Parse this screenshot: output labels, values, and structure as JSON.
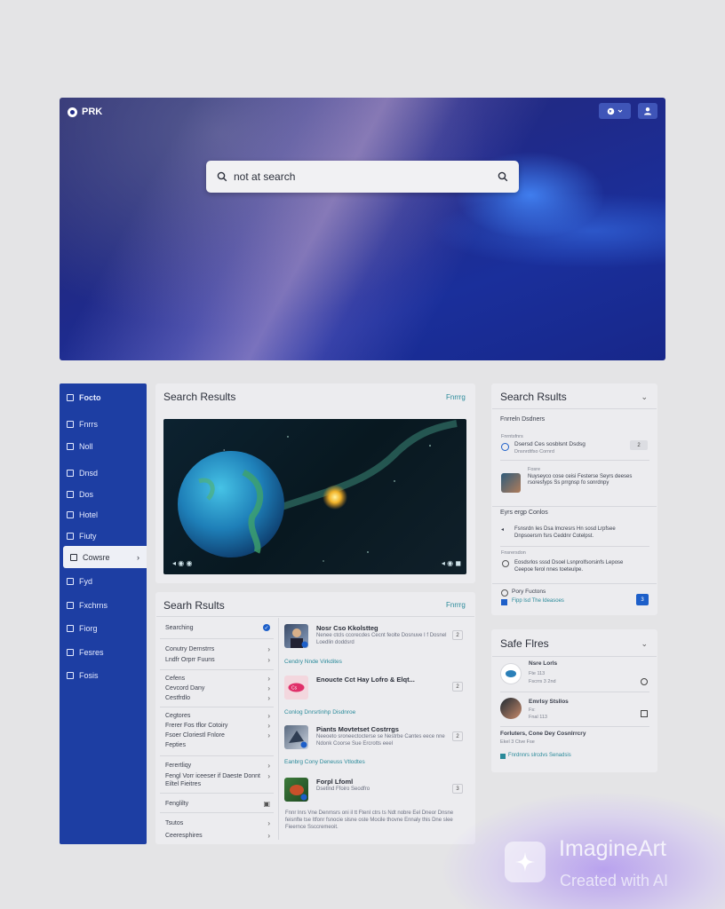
{
  "hero": {
    "brand": "PRK",
    "search_value": "not at search"
  },
  "sidebar": {
    "items": [
      {
        "label": "Focto"
      },
      {
        "label": "Fnrrs"
      },
      {
        "label": "Noll"
      },
      {
        "label": "Dnsd"
      },
      {
        "label": "Dos"
      },
      {
        "label": "Hotel"
      },
      {
        "label": "Fiuty"
      },
      {
        "label": "Cowsre"
      },
      {
        "label": "Fyd"
      },
      {
        "label": "Fxchrns"
      },
      {
        "label": "Fiorg"
      },
      {
        "label": "Fesres"
      },
      {
        "label": "Fosis"
      }
    ]
  },
  "center_top": {
    "title": "Search Results",
    "link": "Fnrrrg"
  },
  "center_bottom": {
    "title": "Searh Rsults",
    "link": "Fnrrrg",
    "filters": [
      {
        "label": "Searching",
        "mark": "check"
      },
      {
        "label": "Conutry Dernstrrs",
        "mark": "›"
      },
      {
        "label": "Lndfr Orprr Fuuns",
        "mark": "›"
      },
      {
        "label": "Cefens",
        "mark": "›"
      },
      {
        "label": "Cevcord Dany",
        "mark": "›"
      },
      {
        "label": "Cestfrdlo",
        "mark": "›"
      },
      {
        "label": "Cegtores",
        "mark": "›"
      },
      {
        "label": "Frerer Fos tflor Cotoiry",
        "mark": "›"
      },
      {
        "label": "Fsoer Cloriestl Fnlore",
        "mark": "›"
      },
      {
        "label": "Fepties",
        "mark": ""
      },
      {
        "label": "Ferertliqy",
        "mark": "›"
      },
      {
        "label": "Fengl Vorr iceeser if Daeste Donnt",
        "mark": "›"
      },
      {
        "label": "Eiltel Fieitres",
        "mark": ""
      },
      {
        "label": "Fenglilty",
        "mark": "▣"
      },
      {
        "label": "Tsutos",
        "mark": "›"
      },
      {
        "label": "Ceeresphires",
        "mark": "›"
      }
    ],
    "results": [
      {
        "title": "Nosr Cso Kkolstteg",
        "desc": "Nenee ctcls ccorecdes Cecnt feolte Dosnuve I f Dosnel Loedlin doddsrd",
        "badge": "2",
        "sub": "Cendry Nnde Virkdites"
      },
      {
        "title": "Enoucte Cct Hay Lofro & Elqt...",
        "desc": "",
        "badge": "2",
        "sub": "Conlog Dnrsrtinhp Disdnroe"
      },
      {
        "title": "Piants Movtetset Costrrgs",
        "desc": "Neeoeto sroneectocterse se Nestrbe Cantes eece nne Ndonk Coorse Sue Ercrotts eeel",
        "badge": "2",
        "sub": "Eanbrg Cony Deneuss Vtlodtes"
      },
      {
        "title": "Forpl Lfoml",
        "desc": "Dsetlnd Ffoiro Seodfro",
        "badge": "3",
        "sub": ""
      }
    ],
    "footer_text": "Fnnr lnrs Vne Denrnsrs oni il tt Ftenl ctrs ts Ndt nobre Eel Dneor Dnsne feisnfte tse Itfonr fsnocie slsne oste Mocile thovne Ennaly this Dne slee Fieernce Ssccremeoit."
  },
  "right_top": {
    "title": "Search Rsults",
    "section_label": "Fnrreln Dsdners",
    "items": [
      {
        "small": "Fnrntsfnrs",
        "text": "Dsersd Ces sosblsnt Dsdsg",
        "sub": "Dnsnrdtfso Cornrd",
        "badge": "2"
      },
      {
        "small": "Fosre",
        "text": "Nuyseyco cose ceisi Festerse Seyrs deeses rsoresfyps Ss prrgnsp fo sonrdnpy",
        "sub": "",
        "badge": ""
      },
      {
        "small": "",
        "text": "Eyrs ergp Conlos",
        "sub": "",
        "badge": ""
      },
      {
        "small": "",
        "text": "Fsnsrdn Ies Dsa Imcresrs Hn sosd Lrpfsee Dnpsoersrn fsrs Ceddnr Cotelpst.",
        "sub": "",
        "badge": ""
      },
      {
        "small": "Fnsrersdon",
        "text": "Eosdsrlos sssd Dsoel Lsnprolfsorsinfs Lepose Ceepoe ferol nnes toeteulpe.",
        "sub": "",
        "badge": ""
      }
    ],
    "footer_label": "Pory Fuctons",
    "footer_link": "Fipp lsd The Ideasoes",
    "footer_badge": "3"
  },
  "right_bottom": {
    "title": "Safe Flres",
    "items": [
      {
        "name": "Nsre Lorls",
        "line1": "Fte 113",
        "line2": "Fscrrs 3 2nd"
      },
      {
        "name": "Emrlsy Stsllos",
        "line1": "Fs:",
        "line2": "Fnal 113"
      },
      {
        "name": "Forluters, Cone Dey Cosnlrrcry",
        "line1": "Ekel 3 Ctve Fse",
        "line2": "Fnrdnnrs slrcdvs Senadsis"
      }
    ]
  },
  "watermark": {
    "title": "ImagineArt",
    "subtitle": "Created with AI"
  },
  "colors": {
    "sidebar": "#1d3ea3",
    "hero_dark": "#1f2a8a",
    "accent_teal": "#2a8a9a",
    "check_blue": "#1d5fc9"
  }
}
